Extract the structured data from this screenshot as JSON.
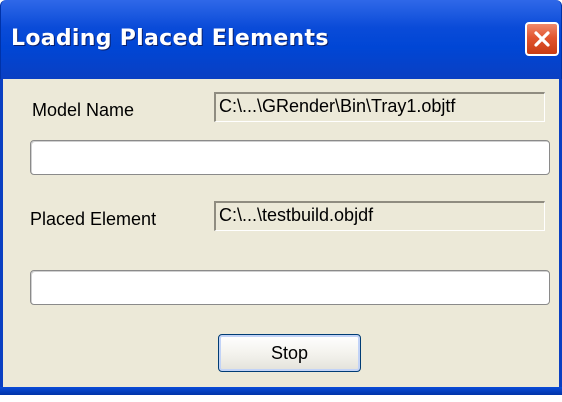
{
  "dialog": {
    "title": "Loading Placed Elements",
    "close_icon": "close-icon"
  },
  "fields": {
    "model_name_label": "Model Name",
    "model_name_value": "C:\\...\\GRender\\Bin\\Tray1.objtf",
    "placed_element_label": "Placed Element",
    "placed_element_value": "C:\\...\\testbuild.objdf"
  },
  "progress": {
    "model_progress_fraction": 0,
    "element_progress_fraction": 0
  },
  "buttons": {
    "stop_label": "Stop"
  },
  "colors": {
    "titlebar": "#0046d5",
    "close_button": "#e2552f",
    "dialog_background": "#ece9d8"
  }
}
